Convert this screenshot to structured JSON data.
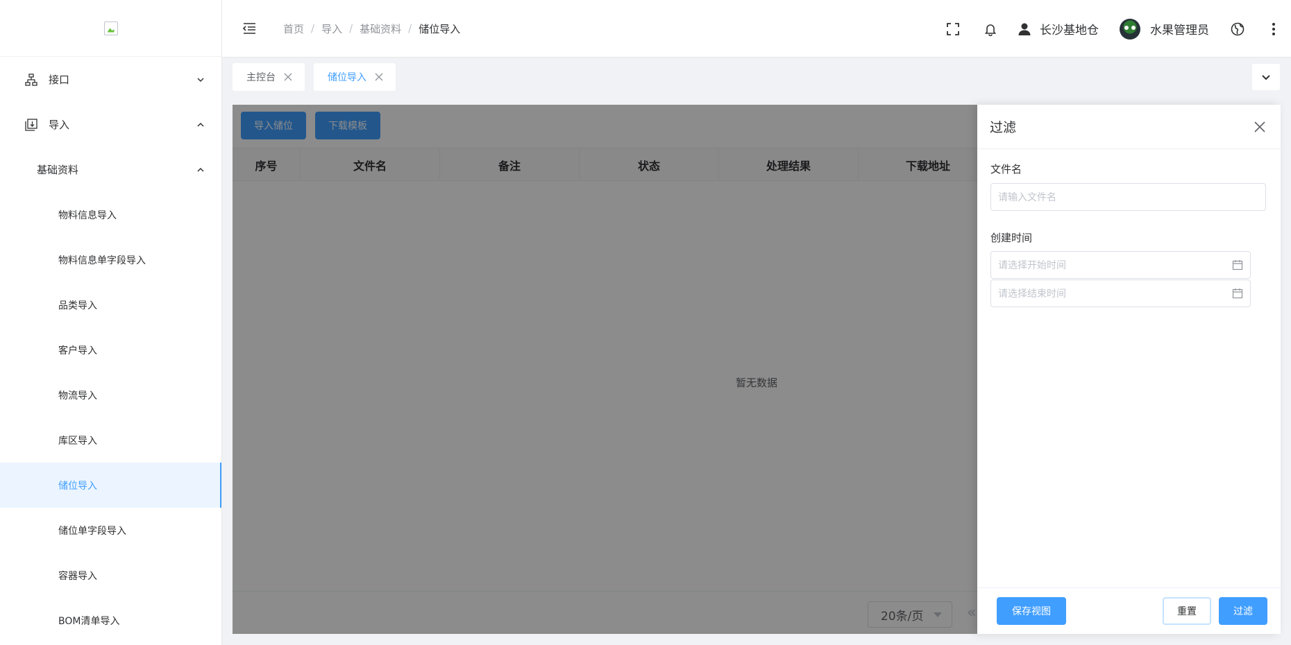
{
  "sidebar": {
    "menu_interface": "接口",
    "menu_import": "导入",
    "menu_basic": "基础资料",
    "items": [
      {
        "label": "物料信息导入"
      },
      {
        "label": "物料信息单字段导入"
      },
      {
        "label": "品类导入"
      },
      {
        "label": "客户导入"
      },
      {
        "label": "物流导入"
      },
      {
        "label": "库区导入"
      },
      {
        "label": "储位导入"
      },
      {
        "label": "储位单字段导入"
      },
      {
        "label": "容器导入"
      },
      {
        "label": "BOM清单导入"
      }
    ]
  },
  "header": {
    "breadcrumb": [
      "首页",
      "导入",
      "基础资料",
      "储位导入"
    ],
    "store": "长沙基地仓",
    "user": "水果管理员"
  },
  "tabs": [
    {
      "label": "主控台"
    },
    {
      "label": "储位导入"
    }
  ],
  "toolbar": {
    "import_label": "导入储位",
    "download_label": "下载模板"
  },
  "table": {
    "columns": [
      "序号",
      "文件名",
      "备注",
      "状态",
      "处理结果",
      "下载地址"
    ],
    "empty_text": "暂无数据"
  },
  "pager": {
    "page_size": "20条/页",
    "prev": "«"
  },
  "drawer": {
    "title": "过滤",
    "filename_label": "文件名",
    "filename_placeholder": "请输入文件名",
    "created_label": "创建时间",
    "start_placeholder": "请选择开始时间",
    "end_placeholder": "请选择结束时间",
    "save_view_label": "保存视图",
    "reset_label": "重置",
    "filter_label": "过滤"
  },
  "colors": {
    "primary": "#409eff",
    "active_bg": "#ecf5ff",
    "mask": "rgba(0,0,0,0.45)"
  }
}
